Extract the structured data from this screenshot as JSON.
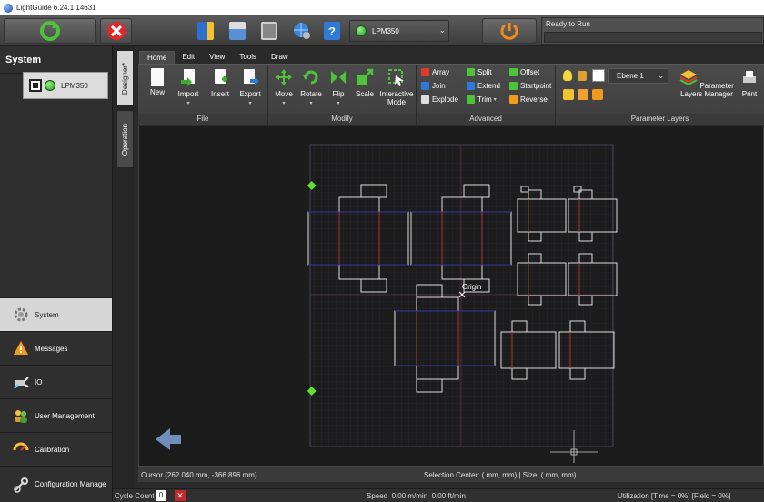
{
  "window": {
    "title": "LightGuide 6.24.1.14631"
  },
  "toolbar": {
    "device_name": "LPM350",
    "status_text": "Ready to Run"
  },
  "left_panel": {
    "header": "System",
    "device_card_label": "LPM350",
    "nav_items": [
      {
        "label": "System",
        "icon": "gear-icon"
      },
      {
        "label": "Messages",
        "icon": "warning-icon"
      },
      {
        "label": "IO",
        "icon": "plug-icon"
      },
      {
        "label": "User Management",
        "icon": "users-icon"
      },
      {
        "label": "Calibration",
        "icon": "calibration-icon"
      },
      {
        "label": "Configuration Manage",
        "icon": "configuration-icon"
      }
    ]
  },
  "side_tabs": {
    "designer": "Designer*",
    "operation": "Operation"
  },
  "ribbon": {
    "tabs": [
      "Home",
      "Edit",
      "View",
      "Tools",
      "Draw"
    ],
    "groups": {
      "file": {
        "label": "File",
        "buttons": [
          "New",
          "Import",
          "Insert",
          "Export"
        ]
      },
      "modify": {
        "label": "Modify",
        "buttons": [
          "Move",
          "Rotate",
          "Flip",
          "Scale",
          "Interactive Mode"
        ]
      },
      "advanced": {
        "label": "Advanced",
        "items": [
          "Array",
          "Split",
          "Offset",
          "Join",
          "Extend",
          "Startpoint",
          "Explode",
          "Trim",
          "Reverse"
        ]
      },
      "parameter_layers": {
        "label": "Parameter Layers",
        "layer_name": "Ebene 1",
        "manager_label": "Parameter Layers Manager",
        "print_label": "Print"
      }
    }
  },
  "canvas": {
    "origin_label": "Origin"
  },
  "cursor_bar": {
    "cursor": "Cursor (262.040 mm, -366.896 mm)",
    "selection": "Selection Center: ( mm, mm) | Size: ( mm, mm)"
  },
  "status_bar": {
    "cycle_label": "Cycle Count",
    "cycle_value": "0",
    "speed": "Speed  0.00 m/min  0.00 ft/min",
    "utilization": "Utilization [Time = 0%] [Field = 0%]"
  }
}
